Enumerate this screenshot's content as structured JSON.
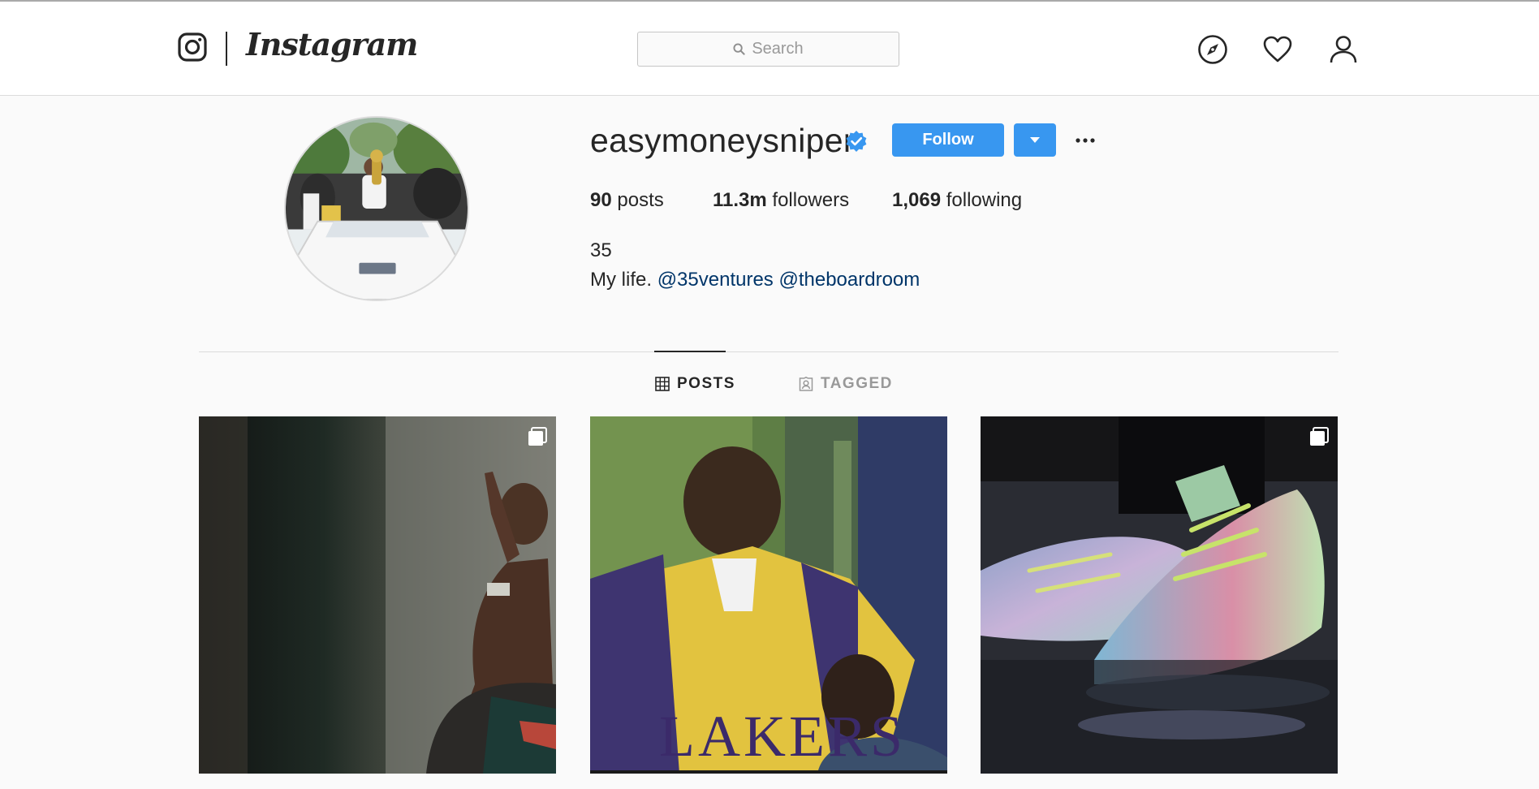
{
  "header": {
    "brand": "Instagram",
    "search_placeholder": "Search",
    "icons": [
      "instagram-glyph-icon",
      "search-icon",
      "compass-icon",
      "heart-icon",
      "user-icon"
    ]
  },
  "profile": {
    "username": "easymoneysniper",
    "verified": true,
    "follow_label": "Follow",
    "stats": {
      "posts_count": "90",
      "posts_label": " posts",
      "followers_count": "11.3m",
      "followers_label": " followers",
      "following_count": "1,069",
      "following_label": " following"
    },
    "bio": {
      "name": "35",
      "text": "My life. ",
      "mention_1": "@35ventures",
      "mention_2": "@theboardroom"
    }
  },
  "tabs": [
    {
      "label": "POSTS",
      "active": true
    },
    {
      "label": "TAGGED",
      "active": false
    }
  ],
  "posts": [
    {
      "kind": "photo",
      "multi": true
    },
    {
      "kind": "photo",
      "multi": false,
      "overlay_text": "LAKERS"
    },
    {
      "kind": "photo",
      "multi": true
    }
  ],
  "colors": {
    "accent": "#3897f0",
    "link": "#003569",
    "text": "#262626",
    "muted": "#999999",
    "border": "#dbdbdb",
    "background": "#fafafa"
  }
}
